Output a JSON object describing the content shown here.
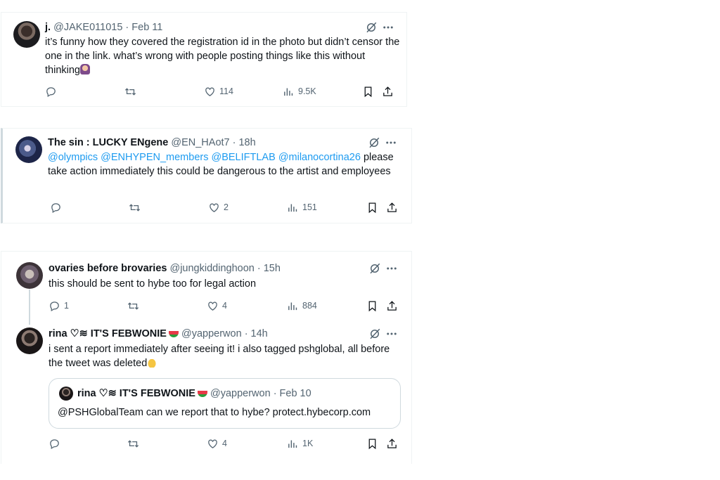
{
  "tweets": [
    {
      "name": "j.",
      "handle": "@JAKE011015",
      "time": "· Feb 11",
      "text": "it’s funny how they covered the registration id in the photo but didn’t censor the one in the link. what’s wrong with people posting things like this without thinking",
      "emoji_icon": "woman-facepalming-emoji",
      "replies": "",
      "retweets": "",
      "likes": "114",
      "views": "9.5K"
    },
    {
      "name": "The sin : LUCKY ENgene",
      "handle": "@EN_HAot7",
      "time": "· 18h",
      "mentions": [
        "@olympics",
        "@ENHYPEN_members",
        "@BELIFTLAB",
        "@milanocortina26"
      ],
      "text_after_mentions": "please take action immediately this could be dangerous to the artist and employees",
      "replies": "",
      "retweets": "",
      "likes": "2",
      "views": "151"
    },
    {
      "name": "ovaries before brovaries",
      "handle": "@jungkiddinghoon",
      "time": "· 15h",
      "text": "this should be sent to hybe too for legal action",
      "replies": "1",
      "retweets": "",
      "likes": "4",
      "views": "884"
    },
    {
      "name": "rina ♡≋ IT'S FEBWONIE",
      "handle": "@yapperwon",
      "time": "· 14h",
      "text": "i sent a report immediately after seeing it! i also tagged pshglobal, all before the tweet was deleted",
      "emoji_icon": "folded-hands-emoji",
      "replies": "",
      "retweets": "",
      "likes": "4",
      "views": "1K",
      "quote": {
        "name": "rina ♡≋ IT'S FEBWONIE",
        "handle": "@yapperwon",
        "time": "· Feb 10",
        "text": "@PSHGlobalTeam can we report that to hybe? protect.hybecorp.com"
      }
    }
  ],
  "icons": {
    "reply": "reply-icon",
    "retweet": "retweet-icon",
    "like": "heart-icon",
    "views": "views-icon",
    "bookmark": "bookmark-icon",
    "share": "share-icon",
    "grok": "grok-icon",
    "more": "more-icon"
  },
  "colors": {
    "text": "#0f1419",
    "meta": "#536471",
    "mention": "#1d9bf0",
    "border": "#eff3f4"
  }
}
